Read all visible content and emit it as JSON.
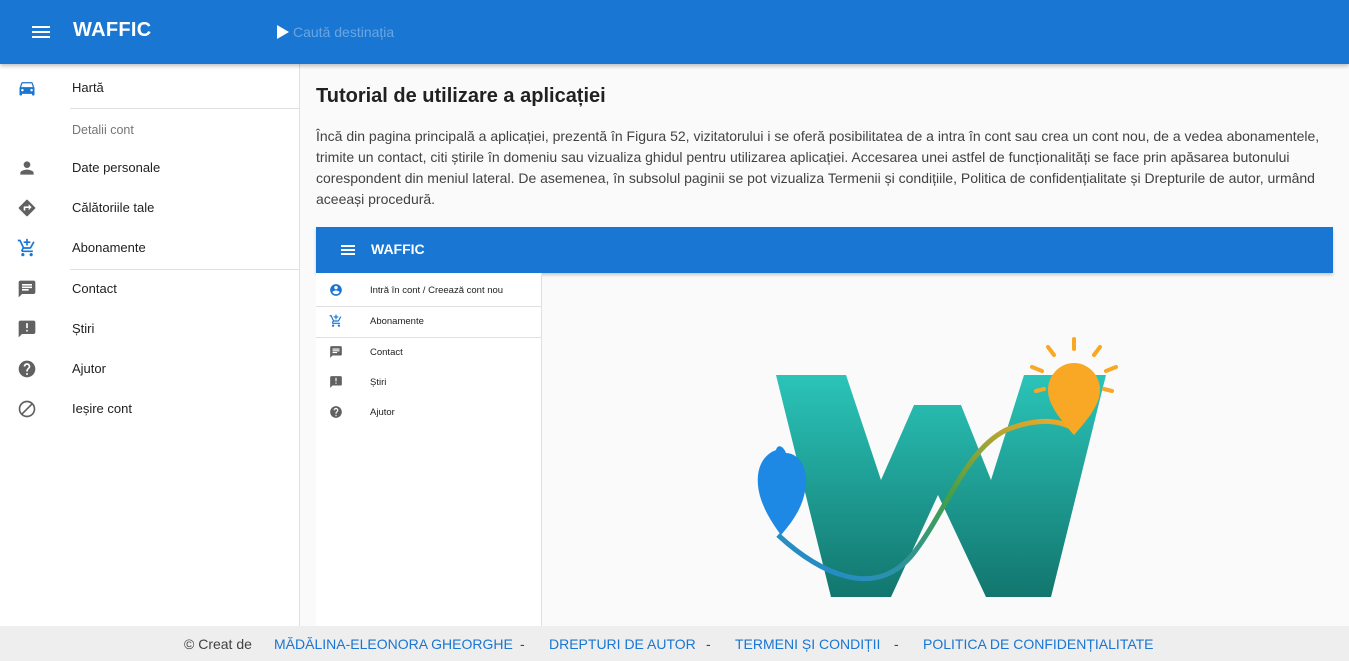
{
  "header": {
    "brand": "WAFFIC",
    "search_placeholder": "Caută destinația",
    "menu_icon": "menu-icon",
    "search_icon": "play-arrow-icon"
  },
  "sidebar": {
    "items_top": [
      {
        "label": "Hartă",
        "icon": "car-icon"
      }
    ],
    "section_header": "Detalii cont",
    "items_account": [
      {
        "label": "Date personale",
        "icon": "person-icon"
      },
      {
        "label": "Călătoriile tale",
        "icon": "directions-icon"
      },
      {
        "label": "Abonamente",
        "icon": "cart-icon"
      }
    ],
    "items_other": [
      {
        "label": "Contact",
        "icon": "chat-icon"
      },
      {
        "label": "Știri",
        "icon": "announcement-icon"
      },
      {
        "label": "Ajutor",
        "icon": "help-icon"
      },
      {
        "label": "Ieșire cont",
        "icon": "block-icon"
      }
    ]
  },
  "main": {
    "title": "Tutorial de utilizare a aplicației",
    "paragraph": "Încă din pagina principală a aplicației, prezentă în Figura 52, vizitatorului i se oferă posibilitatea de a intra în cont sau crea un cont nou, de a vedea abonamentele, trimite un contact, citi știrile în domeniu sau vizualiza ghidul pentru utilizarea aplicației. Accesarea unei astfel de funcționalități se face prin apăsarea butonului corespondent din meniul lateral. De asemenea, în subsolul paginii se pot vizualiza Termenii și condițiile, Politica de confidențialitate și Drepturile de autor, urmând aceeași procedură."
  },
  "figure": {
    "brand": "WAFFIC",
    "items": [
      {
        "label": "Intră în cont / Creează cont nou",
        "icon": "account-circle-icon"
      },
      {
        "label": "Abonamente",
        "icon": "cart-icon"
      },
      {
        "label": "Contact",
        "icon": "chat-icon"
      },
      {
        "label": "Știri",
        "icon": "announcement-icon"
      },
      {
        "label": "Ajutor",
        "icon": "help-icon"
      }
    ],
    "logo_icon": "waffic-logo"
  },
  "footer": {
    "created_by": "© Creat de",
    "author": "MĂDĂLINA-ELEONORA GHEORGHE",
    "sep": "-",
    "copyright": "DREPTURI DE AUTOR",
    "terms": "TERMENI ȘI CONDIȚII",
    "privacy": "POLITICA DE CONFIDENȚIALITATE"
  },
  "colors": {
    "primary": "#1976d2",
    "sidebar_icon": "#616161",
    "active_icon": "#1976d2",
    "logo_teal": "#26a69a",
    "logo_orange": "#f9a825",
    "logo_blue": "#1e88e5"
  }
}
